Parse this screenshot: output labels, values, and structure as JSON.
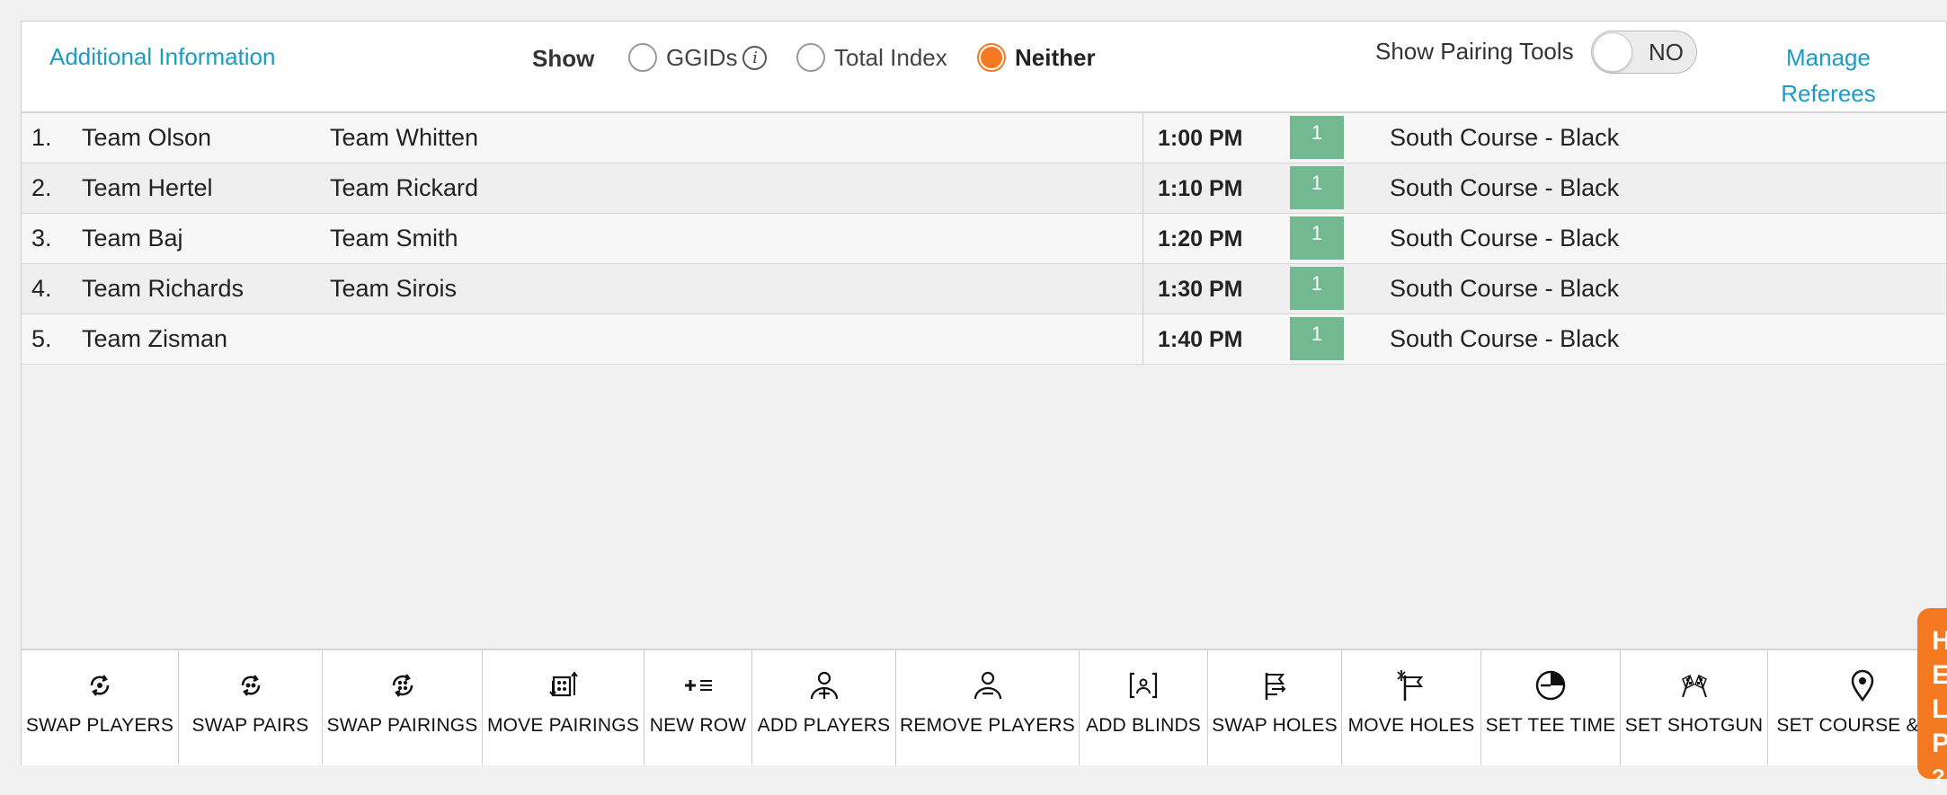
{
  "header": {
    "additional_info": "Additional Information",
    "show_label": "Show",
    "radios": [
      {
        "label": "GGIDs",
        "selected": false,
        "info": "i"
      },
      {
        "label": "Total Index",
        "selected": false
      },
      {
        "label": "Neither",
        "selected": true
      }
    ],
    "pairing_tools_label": "Show Pairing Tools",
    "pairing_tools_value": "NO",
    "manage_line1": "Manage",
    "manage_line2": "Referees"
  },
  "pairings": [
    {
      "num": "1.",
      "team1": "Team Olson",
      "team2": "Team Whitten",
      "time": "1:00 PM",
      "hole": "1",
      "course": "South Course - Black"
    },
    {
      "num": "2.",
      "team1": "Team Hertel",
      "team2": "Team Rickard",
      "time": "1:10 PM",
      "hole": "1",
      "course": "South Course - Black"
    },
    {
      "num": "3.",
      "team1": "Team Baj",
      "team2": "Team Smith",
      "time": "1:20 PM",
      "hole": "1",
      "course": "South Course - Black"
    },
    {
      "num": "4.",
      "team1": "Team Richards",
      "team2": "Team Sirois",
      "time": "1:30 PM",
      "hole": "1",
      "course": "South Course - Black"
    },
    {
      "num": "5.",
      "team1": "Team Zisman",
      "team2": "",
      "time": "1:40 PM",
      "hole": "1",
      "course": "South Course - Black"
    }
  ],
  "toolbar": [
    {
      "label": "SWAP PLAYERS",
      "icon": "swap-players-icon"
    },
    {
      "label": "SWAP PAIRS",
      "icon": "swap-pairs-icon"
    },
    {
      "label": "SWAP PAIRINGS",
      "icon": "swap-pairings-icon"
    },
    {
      "label": "MOVE PAIRINGS",
      "icon": "move-pairings-icon"
    },
    {
      "label": "NEW ROW",
      "icon": "new-row-icon"
    },
    {
      "label": "ADD PLAYERS",
      "icon": "add-player-icon"
    },
    {
      "label": "REMOVE PLAYERS",
      "icon": "remove-player-icon"
    },
    {
      "label": "ADD BLINDS",
      "icon": "add-blinds-icon"
    },
    {
      "label": "SWAP HOLES",
      "icon": "swap-holes-icon"
    },
    {
      "label": "MOVE HOLES",
      "icon": "move-holes-icon"
    },
    {
      "label": "SET TEE TIME",
      "icon": "clock-icon"
    },
    {
      "label": "SET SHOTGUN",
      "icon": "checkered-flags-icon"
    },
    {
      "label": "SET COURSE & TE",
      "icon": "map-pin-icon"
    }
  ],
  "help_letters": [
    "H",
    "E",
    "L",
    "P",
    "?"
  ],
  "colors": {
    "accent": "#f47920",
    "link": "#1a9cc4",
    "hole_badge": "#72b991"
  }
}
